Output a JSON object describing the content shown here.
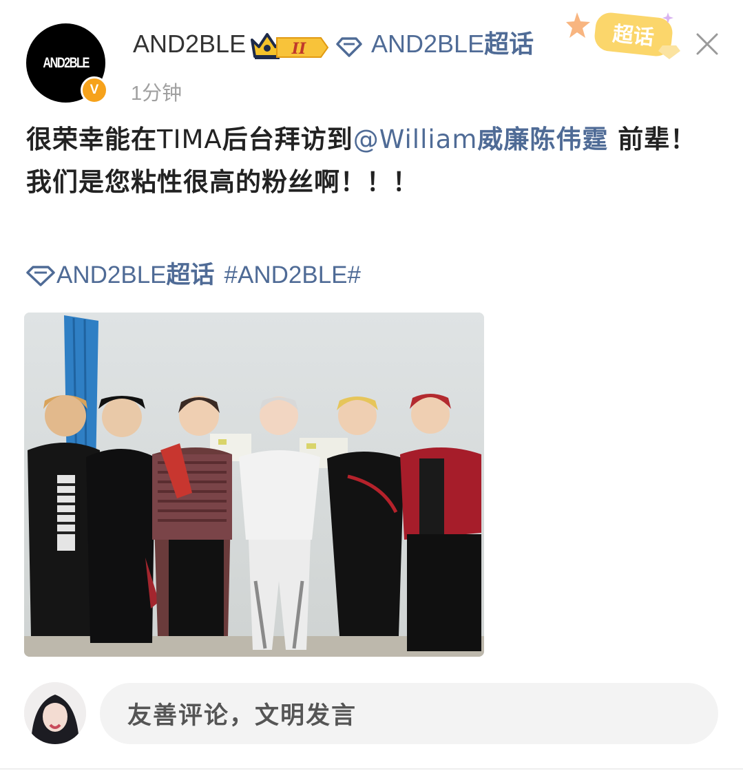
{
  "post": {
    "avatar_text": "AND2BLE",
    "verified_badge": "V",
    "username": "AND2BLE",
    "rank_badge": "II",
    "topic_chip_prefix": "AND2BLE",
    "topic_chip_suffix": "超话",
    "sticker_label": "超话",
    "timestamp": "1分钟",
    "icons": {
      "crown": "crown-icon",
      "diamond": "diamond-icon",
      "close": "close-icon"
    },
    "text": {
      "line1_before": "很荣幸能在",
      "line1_latin": "TIMA",
      "line1_middle": "后台拜访到",
      "mention_prefix": "@William",
      "mention_name": "威廉陈伟霆",
      "line1_after": " 前辈！",
      "line2": "我们是您粘性很高的粉丝啊！！！"
    },
    "tags": {
      "supertopic_prefix": "AND2BLE",
      "supertopic_suffix": "超话",
      "hashtag": "#AND2BLE#"
    }
  },
  "comment_bar": {
    "placeholder": "友善评论，文明发言"
  },
  "colors": {
    "link": "#4f6b96",
    "badge_orange": "#f6a21b",
    "gold": "#f5c22a"
  }
}
